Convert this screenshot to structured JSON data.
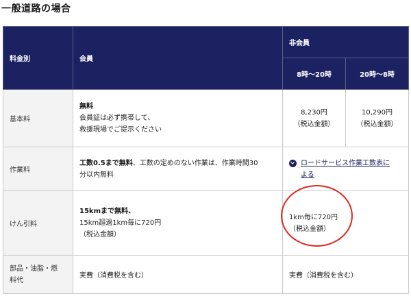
{
  "section_title": "一般道路の場合",
  "header": {
    "category": "料金別",
    "member": "会員",
    "nonmember": "非会員",
    "day": "8時〜20時",
    "night": "20時〜8時"
  },
  "rows": {
    "basic": {
      "label": "基本料",
      "member_bold": "無料",
      "member_line2": "会員証は必ず携帯して、",
      "member_line3": "救援現場でご提示ください",
      "day_price": "8,230円",
      "day_tax": "（税込金額）",
      "night_price": "10,290円",
      "night_tax": "（税込金額）"
    },
    "work": {
      "label": "作業料",
      "member_bold": "工数0.5まで無料",
      "member_rest": "、工数の定めのない作業は、作業時間30",
      "member_line2": "分以内無料",
      "link_line1": "ロードサービス作業工数表に",
      "link_line2": "よる"
    },
    "tow": {
      "label": "けん引料",
      "member_bold": "15kmまで無料、",
      "member_line2": "15km超過1km毎に720円",
      "member_line3": "（税込金額）",
      "nonmember_line1": "1km毎に720円",
      "nonmember_line2": "（税込金額）"
    },
    "parts": {
      "label_line1": "部品・油脂・燃",
      "label_line2": "料代",
      "member": "実費（消費税を含む）",
      "nonmember": "実費（消費税を含む）"
    }
  },
  "annotation_color": "#e0281e",
  "header_color": "#1b2161"
}
